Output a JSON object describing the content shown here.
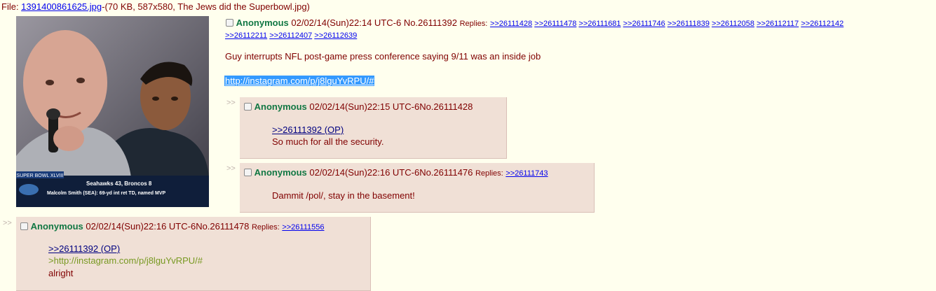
{
  "file_info": {
    "prefix": "File: ",
    "filename": "1391400861625.jpg",
    "details": "-(70 KB, 587x580, The Jews did the Superbowl.jpg)"
  },
  "thumbnail": {
    "chyron_title": "SUPER BOWL XLVIII",
    "chyron_score": "Seahawks 43, Broncos 8",
    "chyron_caption": "Malcolm Smith (SEA): 69-yd int ret TD, named MVP"
  },
  "op": {
    "name": "Anonymous",
    "datetime": "02/02/14(Sun)22:14 UTC-6",
    "number": "No.26111392",
    "replies_label": "Replies:",
    "replies": [
      ">>26111428",
      ">>26111478",
      ">>26111681",
      ">>26111746",
      ">>26111839",
      ">>26112058",
      ">>26112117",
      ">>26112142",
      ">>26112211",
      ">>26112407",
      ">>26112639"
    ],
    "message": "Guy interrupts NFL post-game press conference saying 9/11 was an inside job",
    "link": "http://instagram.com/p/j8lguYvRPU/#"
  },
  "quote_arrow": ">>",
  "posts": [
    {
      "name": "Anonymous",
      "datetime": "02/02/14(Sun)22:15 UTC-6",
      "number": "No.26111428",
      "quote_link": ">>26111392 (OP)",
      "text": "So much for all the security."
    },
    {
      "name": "Anonymous",
      "datetime": "02/02/14(Sun)22:16 UTC-6",
      "number": "No.26111476",
      "replies_label": "Replies:",
      "reply_link": ">>26111743",
      "text": "Dammit /pol/, stay in the basement!"
    },
    {
      "name": "Anonymous",
      "datetime": "02/02/14(Sun)22:16 UTC-6",
      "number": "No.26111478",
      "replies_label": "Replies:",
      "reply_link": ">>26111556",
      "quote_link": ">>26111392 (OP)",
      "greentext": ">http://instagram.com/p/j8lguYvRPU/#",
      "text": "alright"
    }
  ]
}
